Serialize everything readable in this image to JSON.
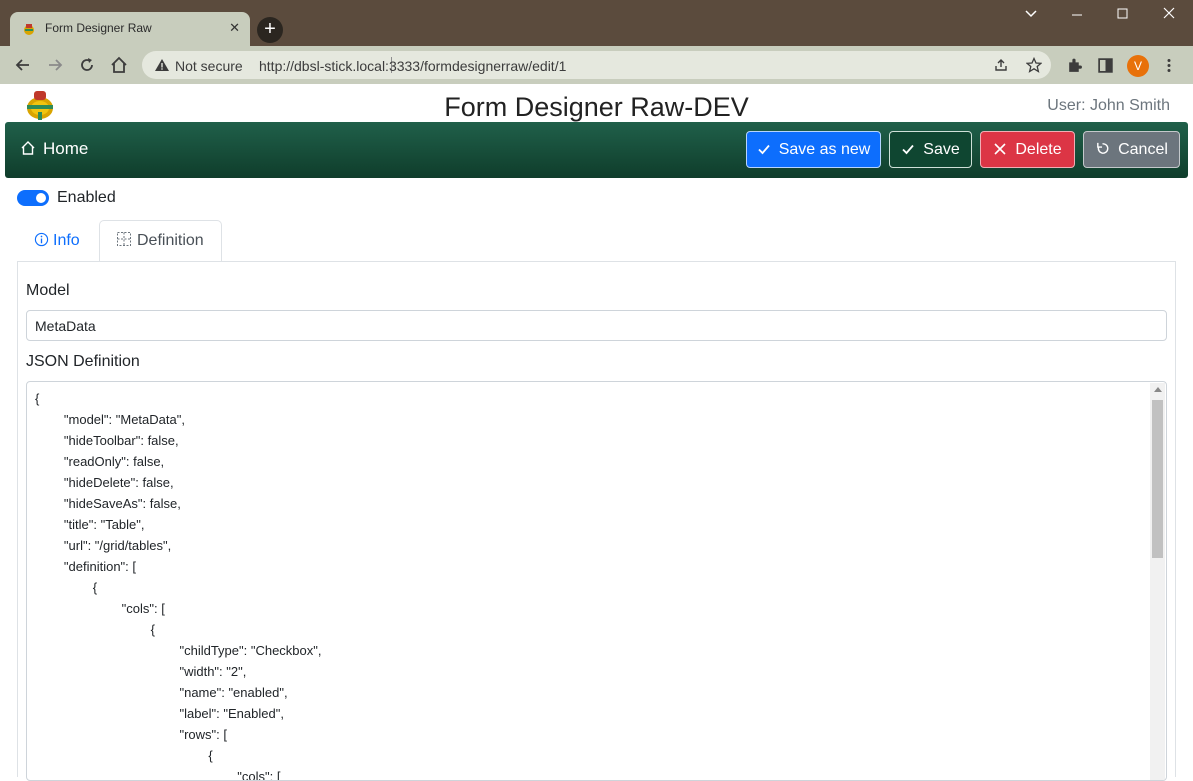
{
  "browser": {
    "tab_title": "Form Designer Raw",
    "security_label": "Not secure",
    "url": "http://dbsl-stick.local:3333/formdesignerraw/edit/1",
    "profile_initial": "V"
  },
  "header": {
    "title": "Form Designer Raw-DEV",
    "user": "User: John Smith"
  },
  "navbar": {
    "home_label": "Home",
    "save_as_new_label": "Save as new",
    "save_label": "Save",
    "delete_label": "Delete",
    "cancel_label": "Cancel"
  },
  "form": {
    "enabled_label": "Enabled",
    "enabled": true,
    "tabs": [
      {
        "label": "Info",
        "active": false
      },
      {
        "label": "Definition",
        "active": true
      }
    ],
    "model_label": "Model",
    "model_value": "MetaData",
    "json_label": "JSON Definition",
    "json_lines": [
      "{",
      "        \"model\": \"MetaData\",",
      "        \"hideToolbar\": false,",
      "        \"readOnly\": false,",
      "        \"hideDelete\": false,",
      "        \"hideSaveAs\": false,",
      "        \"title\": \"Table\",",
      "        \"url\": \"/grid/tables\",",
      "        \"definition\": [",
      "                {",
      "                        \"cols\": [",
      "                                {",
      "                                        \"childType\": \"Checkbox\",",
      "                                        \"width\": \"2\",",
      "                                        \"name\": \"enabled\",",
      "                                        \"label\": \"Enabled\",",
      "                                        \"rows\": [",
      "                                                {",
      "                                                        \"cols\": ["
    ]
  },
  "colors": {
    "navbar": "#1a5540",
    "primary": "#0d6efd",
    "save": "#0f4631",
    "danger": "#dc3545",
    "secondary": "#6c757d"
  }
}
